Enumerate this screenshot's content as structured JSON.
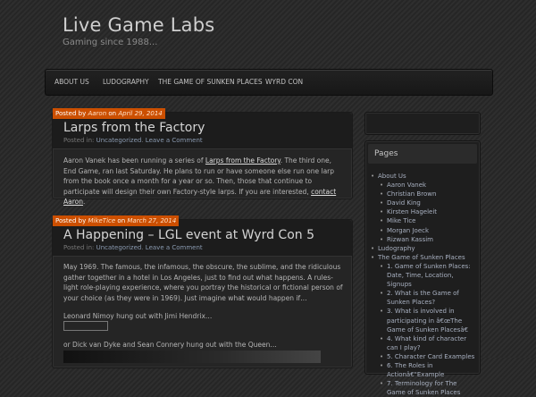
{
  "site": {
    "title": "Live Game Labs",
    "tagline": "Gaming since 1988..."
  },
  "nav": {
    "items": [
      {
        "label": "About Us"
      },
      {
        "label": "Ludography"
      },
      {
        "label": "The Game of Sunken Places"
      },
      {
        "label": "Wyrd Con"
      }
    ]
  },
  "posts": [
    {
      "posted_by_prefix": "Posted by",
      "author": "Aaron",
      "on": "on",
      "date": "April 29, 2014",
      "title": "Larps from the Factory",
      "meta_prefix": "Posted in:",
      "category": "Uncategorized",
      "comment_link": "Leave a Comment",
      "body_1": "Aaron Vanek has been running a series of ",
      "body_link_1": "Larps from the Factory",
      "body_2": ". The third one, End Game, ran last Saturday. He plans to run or have someone else run one larp from the book once a month for a year or so. Then, those that continue to participate will design their own Factory-style larps. If you are interested, ",
      "body_link_2": "contact Aaron",
      "body_3": "."
    },
    {
      "posted_by_prefix": "Posted by",
      "author": "MikeTice",
      "on": "on",
      "date": "March 27, 2014",
      "title": "A Happening – LGL event at Wyrd Con 5",
      "meta_prefix": "Posted in:",
      "category": "Uncategorized",
      "comment_link": "Leave a Comment",
      "body_1": "May 1969. The famous, the infamous, the obscure, the sublime, and the ridiculous gather together in a hotel in Los Angeles, just to find out what happens. A rules-light role-playing experience, where you portray the historical or fictional person of your choice (as they were in 1969). Just imagine what would happen if…",
      "line_2": "Leonard Nimoy hung out with Jimi Hendrix…",
      "line_3": "or Dick van Dyke and Sean Connery hung out with the Queen…"
    }
  ],
  "sidebar": {
    "pages_title": "Pages",
    "pages": [
      {
        "label": "About Us",
        "level": 0
      },
      {
        "label": "Aaron Vanek",
        "level": 1
      },
      {
        "label": "Christian Brown",
        "level": 1
      },
      {
        "label": "David King",
        "level": 1
      },
      {
        "label": "Kirsten Hageleit",
        "level": 1
      },
      {
        "label": "Mike Tice",
        "level": 1
      },
      {
        "label": "Morgan Joeck",
        "level": 1
      },
      {
        "label": "Rizwan Kassim",
        "level": 1
      },
      {
        "label": "Ludography",
        "level": 0
      },
      {
        "label": "The Game of Sunken Places",
        "level": 0
      },
      {
        "label": "1. Game of Sunken Places: Date, Time, Location, Signups",
        "level": 1
      },
      {
        "label": "2. What is the Game of Sunken Places?",
        "level": 1
      },
      {
        "label": "3. What is involved in participating in â€œThe Game of Sunken Placesâ€",
        "level": 1
      },
      {
        "label": "4. What kind of character can I play?",
        "level": 1
      },
      {
        "label": "5. Character Card Examples",
        "level": 1
      },
      {
        "label": "6. The Roles in Actionâ€\"Example",
        "level": 1
      },
      {
        "label": "7. Terminology for The Game of Sunken Places",
        "level": 1
      }
    ]
  }
}
